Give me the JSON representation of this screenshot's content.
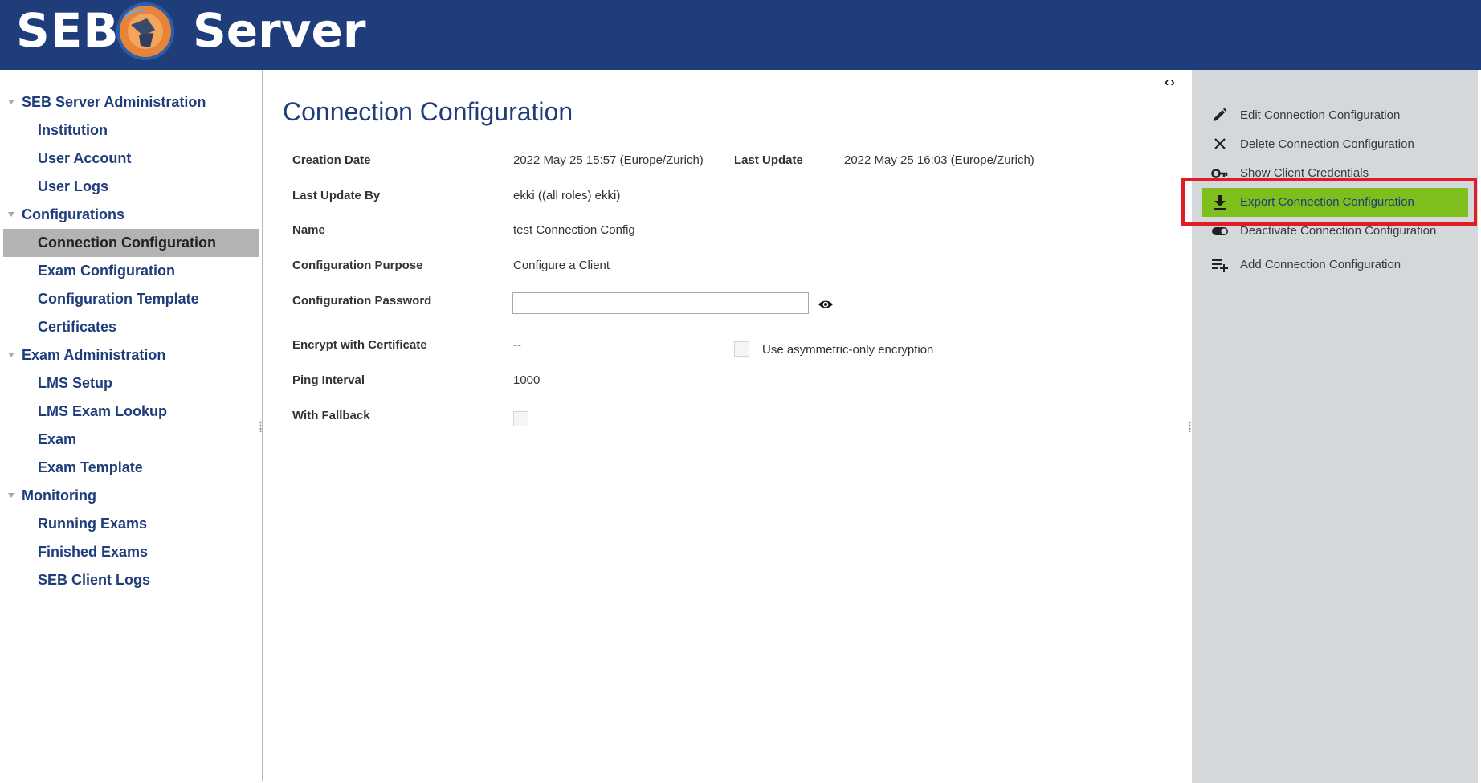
{
  "brand": {
    "left_text": "SEB",
    "right_text": "Server"
  },
  "colors": {
    "header": "#1f3d7a",
    "accent": "#7fbf1d",
    "highlight_frame": "#e21c24",
    "action_panel": "#d5d8da"
  },
  "nav": {
    "sections": [
      {
        "label": "SEB Server Administration",
        "items": [
          "Institution",
          "User Account",
          "User Logs"
        ]
      },
      {
        "label": "Configurations",
        "items": [
          "Connection Configuration",
          "Exam Configuration",
          "Configuration Template",
          "Certificates"
        ]
      },
      {
        "label": "Exam Administration",
        "items": [
          "LMS Setup",
          "LMS Exam Lookup",
          "Exam",
          "Exam Template"
        ]
      },
      {
        "label": "Monitoring",
        "items": [
          "Running Exams",
          "Finished Exams",
          "SEB Client Logs"
        ]
      }
    ],
    "selected": "Connection Configuration"
  },
  "main": {
    "title": "Connection Configuration",
    "fields": {
      "creation_date": {
        "label": "Creation Date",
        "value": "2022 May 25 15:57 (Europe/Zurich)"
      },
      "last_update": {
        "label": "Last Update",
        "value": "2022 May 25 16:03 (Europe/Zurich)"
      },
      "last_update_by": {
        "label": "Last Update By",
        "value": "ekki ((all roles) ekki)"
      },
      "name": {
        "label": "Name",
        "value": "test Connection Config"
      },
      "purpose": {
        "label": "Configuration Purpose",
        "value": "Configure a Client"
      },
      "password": {
        "label": "Configuration Password",
        "value": ""
      },
      "encrypt": {
        "label": "Encrypt with Certificate",
        "value": "--"
      },
      "asymmetric": {
        "label": "Use asymmetric-only encryption",
        "checked": false
      },
      "ping": {
        "label": "Ping Interval",
        "value": "1000"
      },
      "fallback": {
        "label": "With Fallback",
        "checked": false
      }
    }
  },
  "actions": [
    {
      "label": "Edit Connection Configuration",
      "icon": "pencil-icon"
    },
    {
      "label": "Delete Connection Configuration",
      "icon": "close-icon"
    },
    {
      "label": "Show Client Credentials",
      "icon": "key-icon"
    },
    {
      "label": "Export Connection Configuration",
      "icon": "download-icon",
      "highlighted": true
    },
    {
      "label": "Deactivate Connection Configuration",
      "icon": "toggle-icon"
    },
    {
      "label": "Add Connection Configuration",
      "icon": "playlist-add-icon"
    }
  ]
}
